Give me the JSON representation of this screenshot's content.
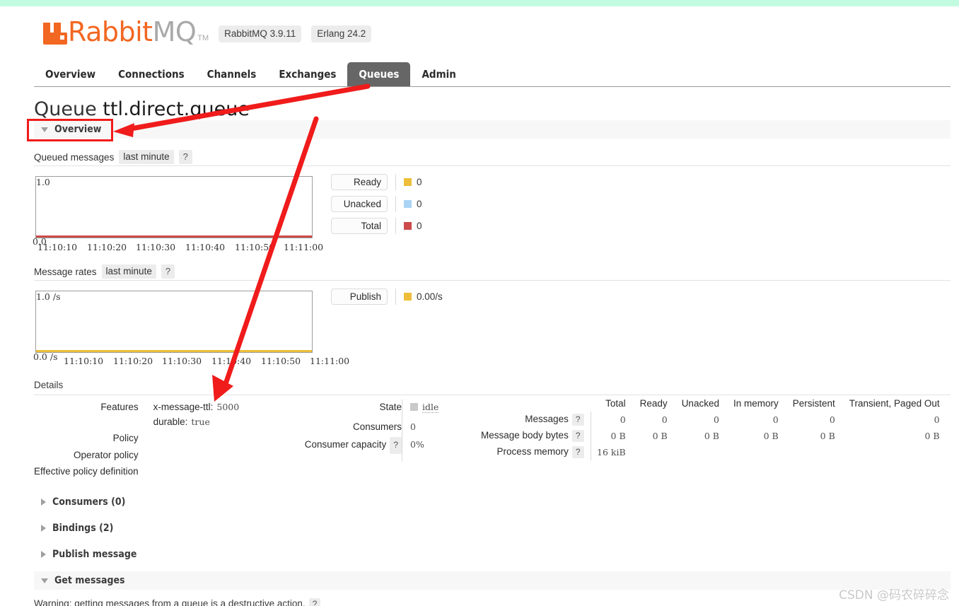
{
  "header": {
    "logo_rabbit": "Rabbit",
    "logo_mq": "MQ",
    "logo_tm": "TM",
    "version_pill": "RabbitMQ 3.9.11",
    "erlang_pill": "Erlang 24.2"
  },
  "nav": {
    "tabs": [
      {
        "label": "Overview",
        "active": false
      },
      {
        "label": "Connections",
        "active": false
      },
      {
        "label": "Channels",
        "active": false
      },
      {
        "label": "Exchanges",
        "active": false
      },
      {
        "label": "Queues",
        "active": true
      },
      {
        "label": "Admin",
        "active": false
      }
    ]
  },
  "page": {
    "title_prefix": "Queue",
    "queue_name": "ttl.direct.queue"
  },
  "sections": {
    "overview": {
      "label": "Overview",
      "expanded": true
    },
    "consumers": {
      "label": "Consumers (0)",
      "expanded": false
    },
    "bindings": {
      "label": "Bindings (2)",
      "expanded": false
    },
    "publish_message": {
      "label": "Publish message",
      "expanded": false
    },
    "get_messages": {
      "label": "Get messages",
      "expanded": true
    }
  },
  "queued_messages": {
    "title": "Queued messages",
    "period": "last minute",
    "help": "?"
  },
  "message_rates": {
    "title": "Message rates",
    "period": "last minute",
    "help": "?"
  },
  "chart_data": [
    {
      "type": "line",
      "title": "Queued messages",
      "subtitle": "last minute",
      "xlabel": "",
      "ylabel": "",
      "ylim": [
        0,
        1.0
      ],
      "y_ticks": [
        "0.0",
        "1.0"
      ],
      "x_ticks": [
        "11:10:10",
        "11:10:20",
        "11:10:30",
        "11:10:40",
        "11:10:50",
        "11:11:00"
      ],
      "grid": false,
      "legend_position": "right",
      "series": [
        {
          "name": "Ready",
          "value": "0",
          "color": "#edbe3a",
          "values": [
            0,
            0,
            0,
            0,
            0,
            0
          ]
        },
        {
          "name": "Unacked",
          "value": "0",
          "color": "#aad4f5",
          "values": [
            0,
            0,
            0,
            0,
            0,
            0
          ]
        },
        {
          "name": "Total",
          "value": "0",
          "color": "#cc4b4b",
          "values": [
            0,
            0,
            0,
            0,
            0,
            0
          ]
        }
      ]
    },
    {
      "type": "line",
      "title": "Message rates",
      "subtitle": "last minute",
      "xlabel": "",
      "ylabel": "",
      "ylim": [
        0,
        1.0
      ],
      "y_ticks": [
        "0.0 /s",
        "1.0 /s"
      ],
      "x_ticks": [
        "11:10:10",
        "11:10:20",
        "11:10:30",
        "11:10:40",
        "11:10:50",
        "11:11:00"
      ],
      "grid": false,
      "legend_position": "right",
      "series": [
        {
          "name": "Publish",
          "value": "0.00/s",
          "color": "#edbe3a",
          "values": [
            0,
            0,
            0,
            0,
            0,
            0
          ]
        }
      ]
    }
  ],
  "details": {
    "label": "Details",
    "features_key": "Features",
    "features": [
      {
        "name": "x-message-ttl:",
        "value": "5000"
      },
      {
        "name": "durable:",
        "value": "true"
      }
    ],
    "policy_key": "Policy",
    "policy_value": "",
    "operator_policy_key": "Operator policy",
    "operator_policy_value": "",
    "effective_policy_key": "Effective policy definition",
    "effective_policy_value": "",
    "state_key": "State",
    "state_value": "idle",
    "consumers_key": "Consumers",
    "consumers_value": "0",
    "consumer_capacity_key": "Consumer capacity",
    "consumer_capacity_help": "?",
    "consumer_capacity_value": "0%"
  },
  "messages_table": {
    "columns": [
      "Total",
      "Ready",
      "Unacked",
      "In memory",
      "Persistent",
      "Transient, Paged Out"
    ],
    "rows": [
      {
        "label": "Messages",
        "help": "?",
        "values": [
          "0",
          "0",
          "0",
          "0",
          "0",
          "0"
        ]
      },
      {
        "label": "Message body bytes",
        "help": "?",
        "values": [
          "0 B",
          "0 B",
          "0 B",
          "0 B",
          "0 B",
          "0 B"
        ]
      },
      {
        "label": "Process memory",
        "help": "?",
        "values": [
          "16 kiB",
          "",
          "",
          "",
          "",
          ""
        ]
      }
    ]
  },
  "bottom": {
    "warning": "Warning: getting messages from a queue is a destructive action.",
    "warning_help": "?"
  },
  "watermark": {
    "text": "CSDN @码农碎碎念"
  },
  "colors": {
    "brand_orange": "#f26722",
    "accent_red": "#f01b1b",
    "ready": "#edbe3a",
    "unacked": "#aad4f5",
    "total": "#cc4b4b",
    "publish": "#edbe3a",
    "active_tab_bg": "#666666",
    "top_strip": "#c2fbe0"
  }
}
